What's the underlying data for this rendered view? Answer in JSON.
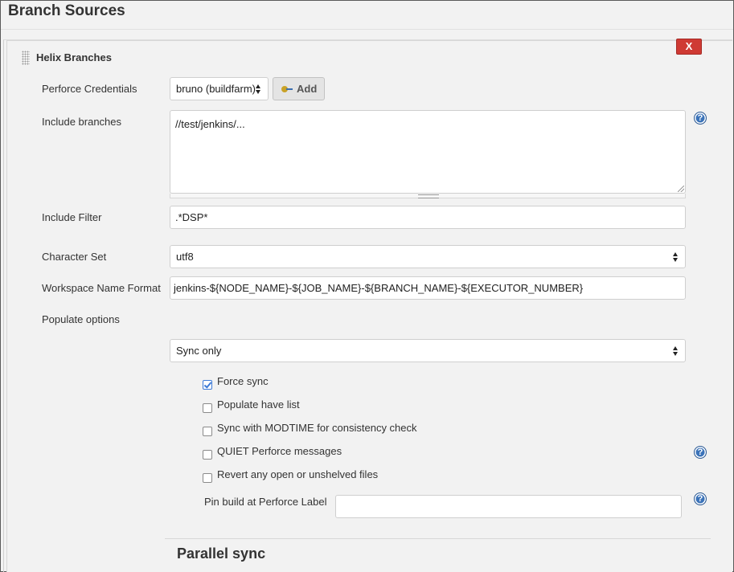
{
  "section": {
    "title": "Branch Sources"
  },
  "branch_block": {
    "title": "Helix Branches",
    "delete_label": "X"
  },
  "credentials": {
    "label": "Perforce Credentials",
    "selected": "bruno (buildfarm)",
    "add_label": "Add"
  },
  "include_branches": {
    "label": "Include branches",
    "value": "//test/jenkins/..."
  },
  "include_filter": {
    "label": "Include Filter",
    "value": ".*DSP*"
  },
  "charset": {
    "label": "Character Set",
    "selected": "utf8"
  },
  "workspace_format": {
    "label": "Workspace Name Format",
    "value": "jenkins-${NODE_NAME}-${JOB_NAME}-${BRANCH_NAME}-${EXECUTOR_NUMBER}"
  },
  "populate": {
    "label": "Populate options",
    "selected": "Sync only",
    "options": [
      {
        "label": "Force sync",
        "checked": true
      },
      {
        "label": "Populate have list",
        "checked": false
      },
      {
        "label": "Sync with MODTIME for consistency check",
        "checked": false
      },
      {
        "label": "QUIET Perforce messages",
        "checked": false
      },
      {
        "label": "Revert any open or unshelved files",
        "checked": false
      }
    ],
    "pin_label": "Pin build at Perforce Label",
    "pin_value": ""
  },
  "parallel": {
    "title": "Parallel sync"
  },
  "help_glyph": "?",
  "colors": {
    "delete_button": "#cf3a34",
    "help_icon": "#3b73b9",
    "checkbox_checked": "#3d7ad6"
  }
}
